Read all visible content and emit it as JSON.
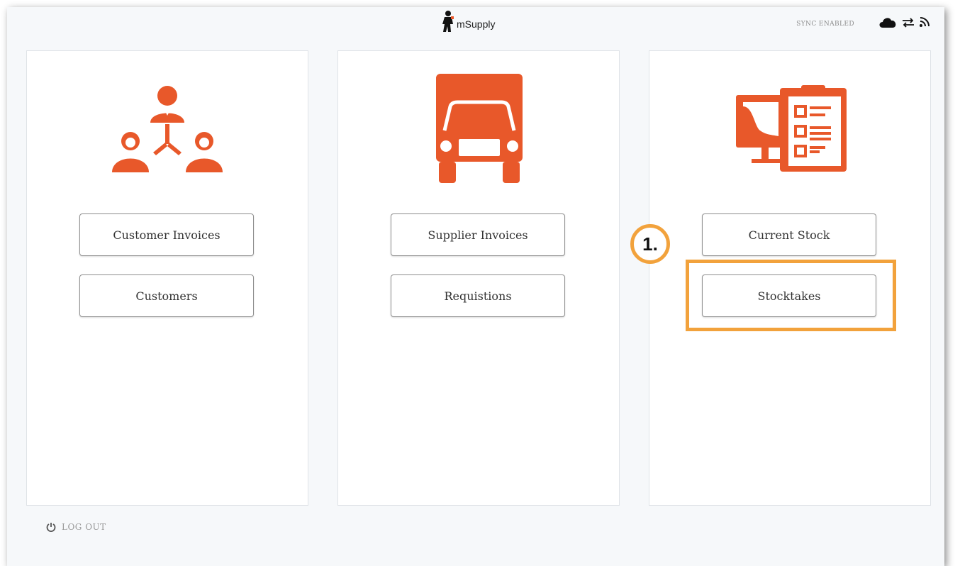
{
  "header": {
    "app_name": "mSupply",
    "sync_status": "SYNC ENABLED",
    "icons": [
      "cloud-icon",
      "sync-arrows-icon",
      "wifi-signal-icon"
    ]
  },
  "panels": [
    {
      "icon": "customers-network-icon",
      "buttons": [
        "Customer Invoices",
        "Customers"
      ]
    },
    {
      "icon": "truck-icon",
      "buttons": [
        "Supplier Invoices",
        "Requistions"
      ]
    },
    {
      "icon": "stock-report-icon",
      "buttons": [
        "Current Stock",
        "Stocktakes"
      ]
    }
  ],
  "annotation": {
    "step_label": "1."
  },
  "footer": {
    "logout_label": "LOG OUT"
  },
  "colors": {
    "accent": "#e8582a",
    "highlight": "#f2a23c"
  }
}
